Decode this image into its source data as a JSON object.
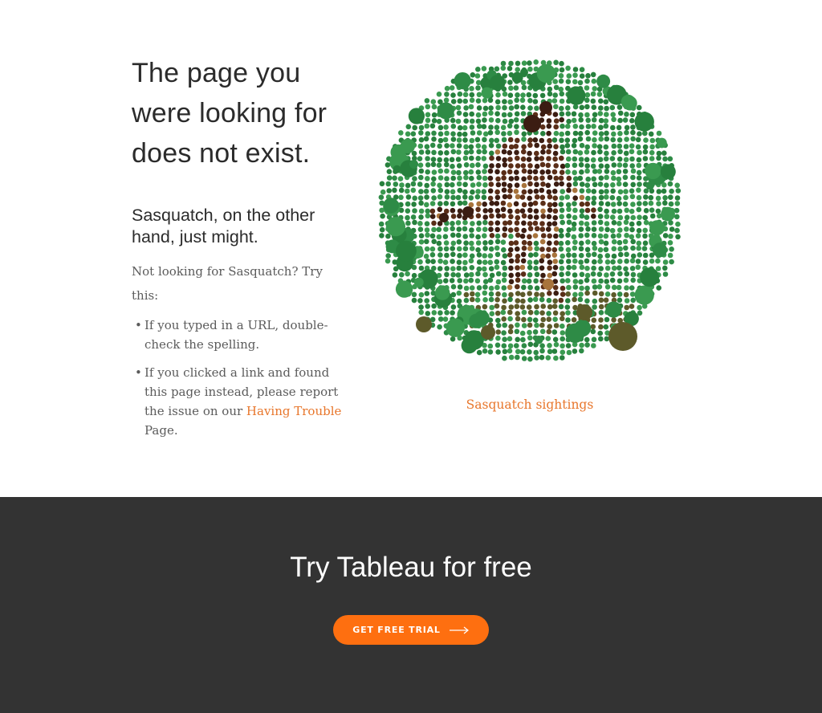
{
  "notfound": {
    "headline": "The page you were looking for does not exist.",
    "subhead": "Sasquatch, on the other hand, just might.",
    "intro": "Not looking for Sasquatch? Try this:",
    "tips": [
      {
        "text": "If you typed in a URL, double-check the spelling."
      },
      {
        "text_before": "If you clicked a link and found this page instead, please report the issue on our ",
        "link_label": "Having Trouble",
        "text_after": " Page."
      }
    ],
    "bullet": "•"
  },
  "figure": {
    "caption": "Sasquatch sightings",
    "colors": {
      "background_dots": [
        "#2e8b46",
        "#3a9a50",
        "#27803d"
      ],
      "figure_dark": "#3b1d12",
      "figure_mid": "#5a2e18",
      "figure_accent": "#a8743c",
      "ground": "#5d5a2a",
      "link": "#e8762b"
    }
  },
  "cta": {
    "title": "Try Tableau for free",
    "button_label": "GET FREE TRIAL",
    "button_icon": "arrow-right-icon",
    "button_color": "#fe6f10"
  }
}
